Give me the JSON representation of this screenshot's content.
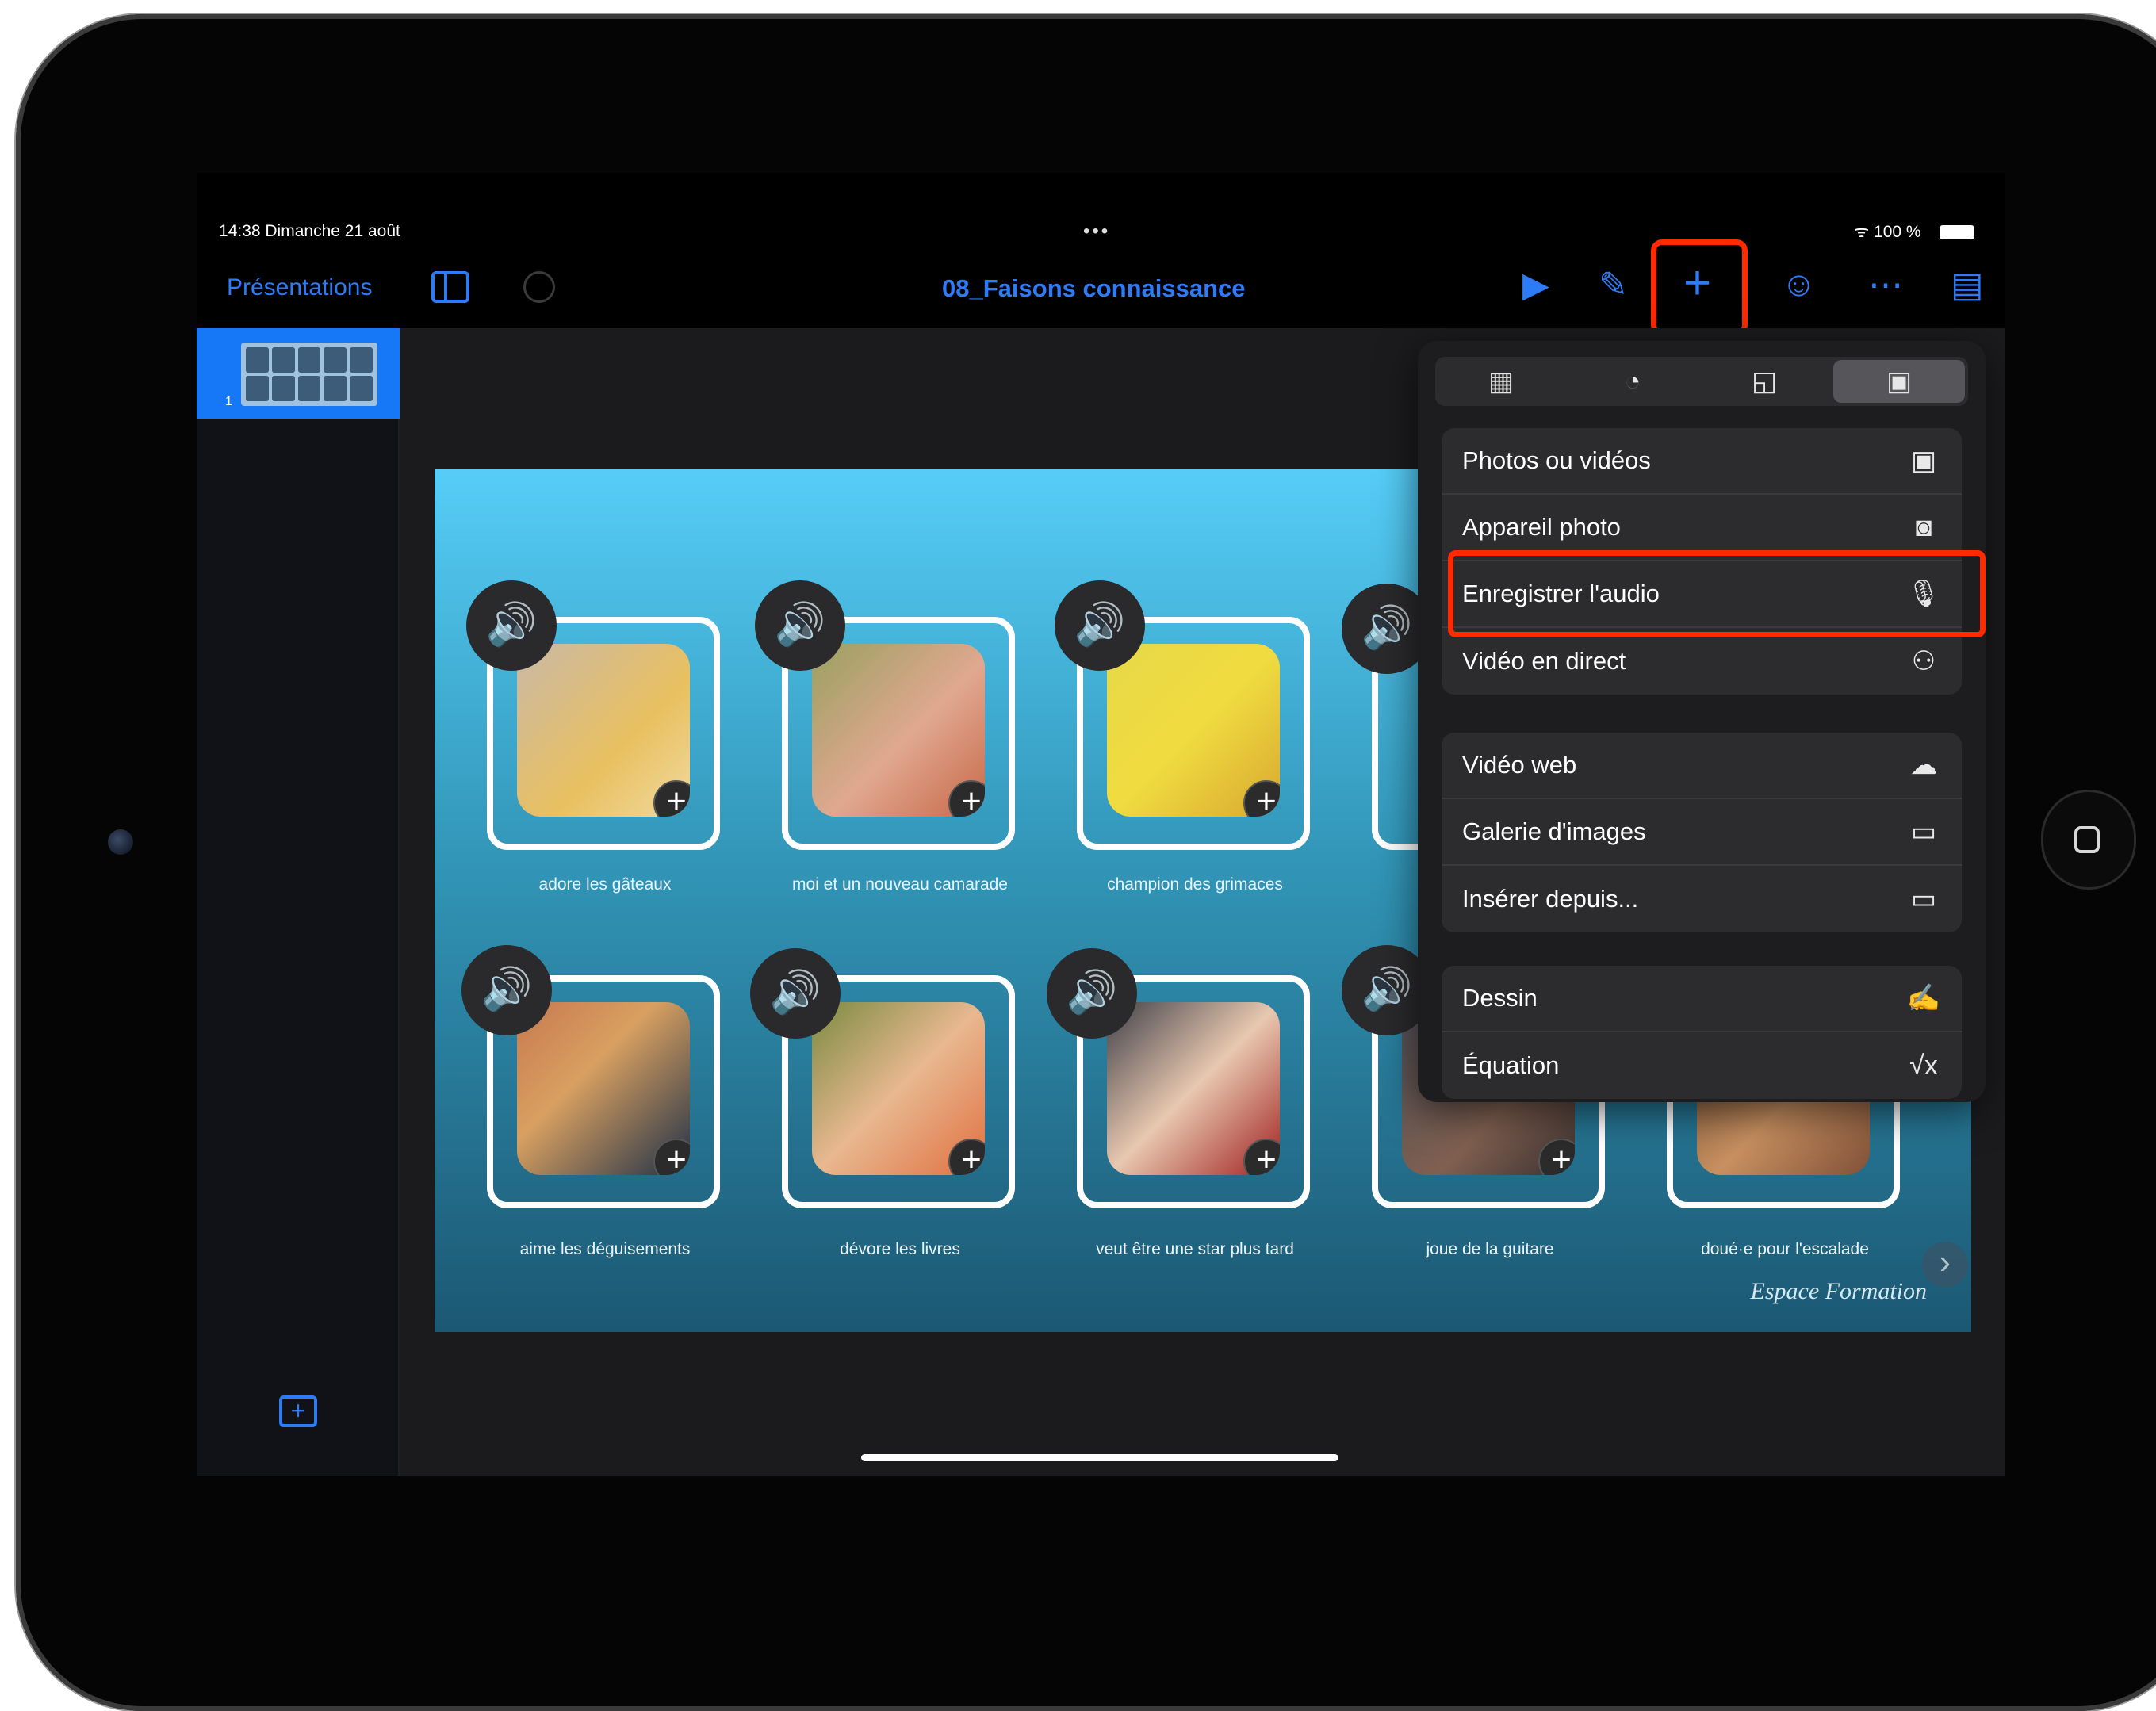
{
  "status_bar": {
    "time": "14:38   Dimanche 21 août",
    "dots": "•••",
    "battery": "100 %"
  },
  "toolbar": {
    "back_label": "Présentations",
    "document_title": "08_Faisons connaissance",
    "play_icon": "▶",
    "brush_icon": "✎",
    "plus_icon": "+",
    "collab_icon": "☺",
    "more_icon": "⋯",
    "doc_icon": "▤"
  },
  "navigator": {
    "slide_number": "1",
    "add_icon": "+"
  },
  "slide": {
    "captions": [
      "adore les gâteaux",
      "moi et un nouveau camarade",
      "champion des grimaces",
      "aime les déguisements",
      "dévore les livres",
      "veut être une star plus tard",
      "joue de la guitare",
      "doué·e pour l'escalade"
    ],
    "speaker_icon": "🔊",
    "photo_plus": "+",
    "watermark": "Espace Formation",
    "next_icon": "›"
  },
  "insert_menu": {
    "tabs": [
      {
        "icon": "table-icon",
        "glyph": "▦"
      },
      {
        "icon": "chart-icon",
        "glyph": "◔"
      },
      {
        "icon": "shape-icon",
        "glyph": "◱"
      },
      {
        "icon": "media-icon",
        "glyph": "▣"
      }
    ],
    "group1": [
      {
        "label": "Photos ou vidéos",
        "icon": "▣"
      },
      {
        "label": "Appareil photo",
        "icon": "◙"
      },
      {
        "label": "Enregistrer l'audio",
        "icon": "🎙"
      },
      {
        "label": "Vidéo en direct",
        "icon": "⚇"
      }
    ],
    "group2": [
      {
        "label": "Vidéo web",
        "icon": "☁"
      },
      {
        "label": "Galerie d'images",
        "icon": "▭"
      },
      {
        "label": "Insérer depuis...",
        "icon": "▭"
      }
    ],
    "group3": [
      {
        "label": "Dessin",
        "icon": "✍"
      },
      {
        "label": "Équation",
        "icon": "√x"
      }
    ]
  },
  "colors": {
    "accent": "#2d7bf6",
    "highlight": "#ff2a00"
  }
}
